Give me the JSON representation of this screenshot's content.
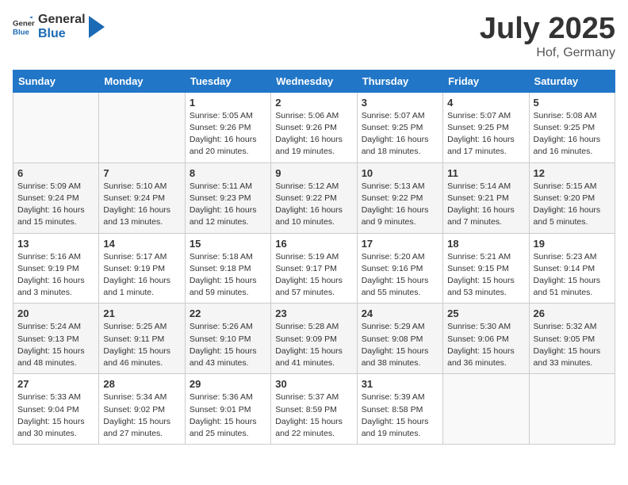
{
  "header": {
    "logo_general": "General",
    "logo_blue": "Blue",
    "month": "July 2025",
    "location": "Hof, Germany"
  },
  "days_of_week": [
    "Sunday",
    "Monday",
    "Tuesday",
    "Wednesday",
    "Thursday",
    "Friday",
    "Saturday"
  ],
  "weeks": [
    [
      {
        "day": "",
        "info": ""
      },
      {
        "day": "",
        "info": ""
      },
      {
        "day": "1",
        "info": "Sunrise: 5:05 AM\nSunset: 9:26 PM\nDaylight: 16 hours\nand 20 minutes."
      },
      {
        "day": "2",
        "info": "Sunrise: 5:06 AM\nSunset: 9:26 PM\nDaylight: 16 hours\nand 19 minutes."
      },
      {
        "day": "3",
        "info": "Sunrise: 5:07 AM\nSunset: 9:25 PM\nDaylight: 16 hours\nand 18 minutes."
      },
      {
        "day": "4",
        "info": "Sunrise: 5:07 AM\nSunset: 9:25 PM\nDaylight: 16 hours\nand 17 minutes."
      },
      {
        "day": "5",
        "info": "Sunrise: 5:08 AM\nSunset: 9:25 PM\nDaylight: 16 hours\nand 16 minutes."
      }
    ],
    [
      {
        "day": "6",
        "info": "Sunrise: 5:09 AM\nSunset: 9:24 PM\nDaylight: 16 hours\nand 15 minutes."
      },
      {
        "day": "7",
        "info": "Sunrise: 5:10 AM\nSunset: 9:24 PM\nDaylight: 16 hours\nand 13 minutes."
      },
      {
        "day": "8",
        "info": "Sunrise: 5:11 AM\nSunset: 9:23 PM\nDaylight: 16 hours\nand 12 minutes."
      },
      {
        "day": "9",
        "info": "Sunrise: 5:12 AM\nSunset: 9:22 PM\nDaylight: 16 hours\nand 10 minutes."
      },
      {
        "day": "10",
        "info": "Sunrise: 5:13 AM\nSunset: 9:22 PM\nDaylight: 16 hours\nand 9 minutes."
      },
      {
        "day": "11",
        "info": "Sunrise: 5:14 AM\nSunset: 9:21 PM\nDaylight: 16 hours\nand 7 minutes."
      },
      {
        "day": "12",
        "info": "Sunrise: 5:15 AM\nSunset: 9:20 PM\nDaylight: 16 hours\nand 5 minutes."
      }
    ],
    [
      {
        "day": "13",
        "info": "Sunrise: 5:16 AM\nSunset: 9:19 PM\nDaylight: 16 hours\nand 3 minutes."
      },
      {
        "day": "14",
        "info": "Sunrise: 5:17 AM\nSunset: 9:19 PM\nDaylight: 16 hours\nand 1 minute."
      },
      {
        "day": "15",
        "info": "Sunrise: 5:18 AM\nSunset: 9:18 PM\nDaylight: 15 hours\nand 59 minutes."
      },
      {
        "day": "16",
        "info": "Sunrise: 5:19 AM\nSunset: 9:17 PM\nDaylight: 15 hours\nand 57 minutes."
      },
      {
        "day": "17",
        "info": "Sunrise: 5:20 AM\nSunset: 9:16 PM\nDaylight: 15 hours\nand 55 minutes."
      },
      {
        "day": "18",
        "info": "Sunrise: 5:21 AM\nSunset: 9:15 PM\nDaylight: 15 hours\nand 53 minutes."
      },
      {
        "day": "19",
        "info": "Sunrise: 5:23 AM\nSunset: 9:14 PM\nDaylight: 15 hours\nand 51 minutes."
      }
    ],
    [
      {
        "day": "20",
        "info": "Sunrise: 5:24 AM\nSunset: 9:13 PM\nDaylight: 15 hours\nand 48 minutes."
      },
      {
        "day": "21",
        "info": "Sunrise: 5:25 AM\nSunset: 9:11 PM\nDaylight: 15 hours\nand 46 minutes."
      },
      {
        "day": "22",
        "info": "Sunrise: 5:26 AM\nSunset: 9:10 PM\nDaylight: 15 hours\nand 43 minutes."
      },
      {
        "day": "23",
        "info": "Sunrise: 5:28 AM\nSunset: 9:09 PM\nDaylight: 15 hours\nand 41 minutes."
      },
      {
        "day": "24",
        "info": "Sunrise: 5:29 AM\nSunset: 9:08 PM\nDaylight: 15 hours\nand 38 minutes."
      },
      {
        "day": "25",
        "info": "Sunrise: 5:30 AM\nSunset: 9:06 PM\nDaylight: 15 hours\nand 36 minutes."
      },
      {
        "day": "26",
        "info": "Sunrise: 5:32 AM\nSunset: 9:05 PM\nDaylight: 15 hours\nand 33 minutes."
      }
    ],
    [
      {
        "day": "27",
        "info": "Sunrise: 5:33 AM\nSunset: 9:04 PM\nDaylight: 15 hours\nand 30 minutes."
      },
      {
        "day": "28",
        "info": "Sunrise: 5:34 AM\nSunset: 9:02 PM\nDaylight: 15 hours\nand 27 minutes."
      },
      {
        "day": "29",
        "info": "Sunrise: 5:36 AM\nSunset: 9:01 PM\nDaylight: 15 hours\nand 25 minutes."
      },
      {
        "day": "30",
        "info": "Sunrise: 5:37 AM\nSunset: 8:59 PM\nDaylight: 15 hours\nand 22 minutes."
      },
      {
        "day": "31",
        "info": "Sunrise: 5:39 AM\nSunset: 8:58 PM\nDaylight: 15 hours\nand 19 minutes."
      },
      {
        "day": "",
        "info": ""
      },
      {
        "day": "",
        "info": ""
      }
    ]
  ]
}
